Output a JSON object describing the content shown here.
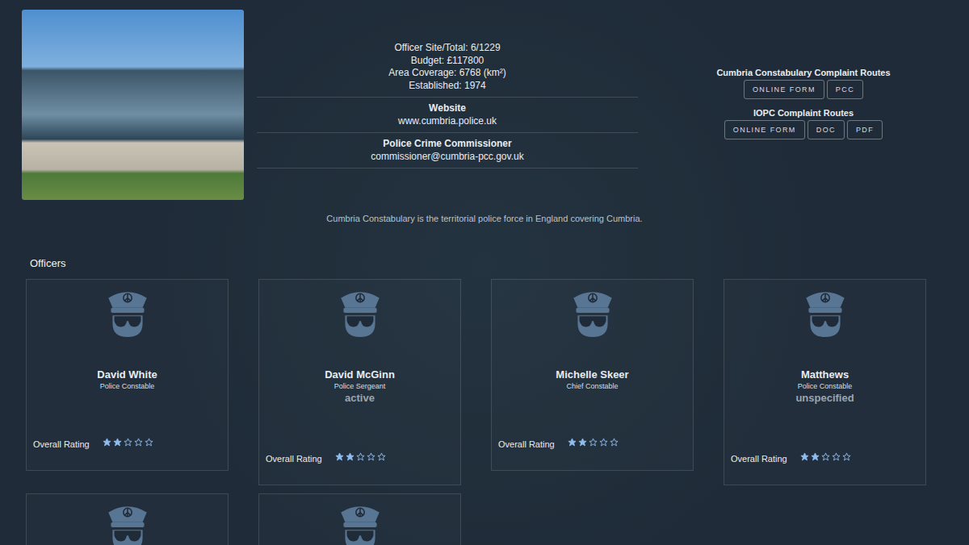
{
  "force": {
    "stats": [
      "Officer Site/Total: 6/1229",
      "Budget: £117800",
      "Area Coverage: 6768 (km²)",
      "Established: 1974"
    ],
    "website_label": "Website",
    "website": "www.cumbria.police.uk",
    "pcc_label": "Police Crime Commissioner",
    "pcc_email": "commissioner@cumbria-pcc.gov.uk",
    "description": "Cumbria Constabulary is the territorial police force in England covering Cumbria."
  },
  "complaint_routes": [
    {
      "title": "Cumbria Constabulary Complaint Routes",
      "buttons": [
        "ONLINE FORM",
        "PCC"
      ]
    },
    {
      "title": "IOPC Complaint Routes",
      "buttons": [
        "ONLINE FORM",
        "DOC",
        "PDF"
      ]
    }
  ],
  "officers_heading": "Officers",
  "officers": [
    {
      "kind": "full",
      "name": "David White",
      "rank": "Police Constable",
      "rating_label": "Overall Rating",
      "stars": 2
    },
    {
      "kind": "full",
      "name": "David McGinn",
      "rank": "Police Sergeant",
      "status": "active",
      "rating_label": "Overall Rating",
      "stars": 2
    },
    {
      "kind": "full",
      "name": "Michelle Skeer",
      "rank": "Chief Constable",
      "rating_label": "Overall Rating",
      "stars": 2
    },
    {
      "kind": "full",
      "name": "Matthews",
      "rank": "Police Constable",
      "status": "unspecified",
      "rating_label": "Overall Rating",
      "stars": 2
    },
    {
      "kind": "cut"
    },
    {
      "kind": "cut"
    }
  ]
}
